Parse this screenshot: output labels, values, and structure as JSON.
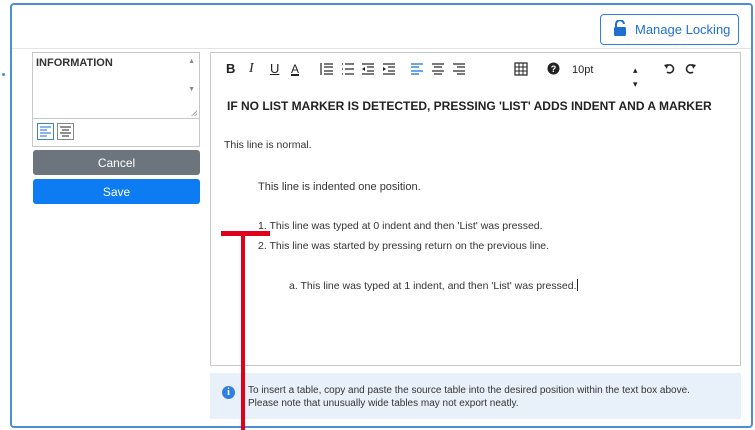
{
  "header": {
    "lock_button_label": "Manage Locking"
  },
  "left_panel": {
    "field_label": "INFORMATION",
    "cancel_label": "Cancel",
    "save_label": "Save"
  },
  "toolbar": {
    "bold": "B",
    "italic": "I",
    "underline": "U",
    "font_color": "A",
    "font_size": "10pt",
    "icons": [
      "ordered-list-icon",
      "bullet-list-icon",
      "outdent-icon",
      "indent-icon",
      "align-left-icon",
      "align-center-icon",
      "align-right-icon",
      "table-icon",
      "help-icon",
      "font-size-stepper",
      "undo-icon",
      "redo-icon"
    ]
  },
  "editor": {
    "heading": "IF NO LIST MARKER IS DETECTED, PRESSING 'LIST' ADDS INDENT AND A MARKER",
    "lines": [
      "This line is normal.",
      "This line is indented one position.",
      "1. This line was typed at 0 indent and then 'List' was pressed.",
      "2. This line was started by pressing return on the previous line.",
      "a. This line was typed at 1 indent, and then 'List' was pressed."
    ]
  },
  "note": {
    "line1": "To insert a table, copy and paste the source table into the desired position within the text box above.",
    "line2": "Please note that unusually wide tables may not export neatly."
  },
  "colors": {
    "accent": "#2a7fe0",
    "save": "#0d7cf2",
    "cancel": "#6c757d",
    "annotation": "#e0001b",
    "note_bg": "#e8f0fa"
  }
}
